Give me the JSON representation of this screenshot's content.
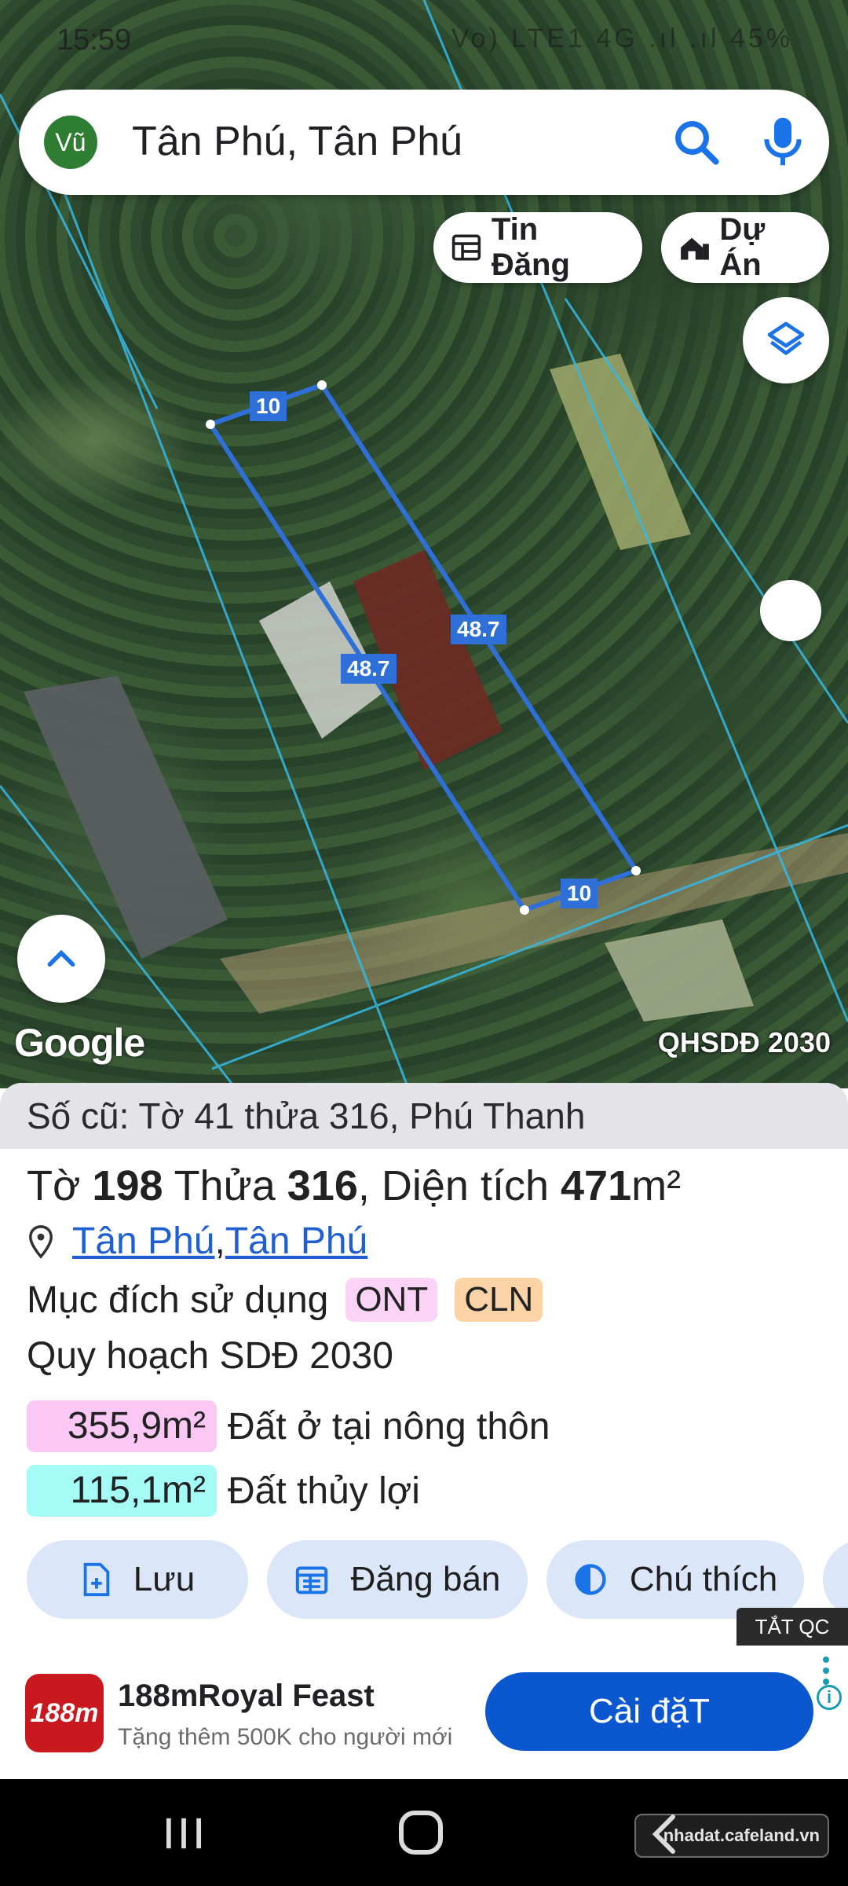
{
  "status_bar": {
    "time": "15:59",
    "indicators": "Vo) LTE1 4G .ıl .ıl 45%"
  },
  "search": {
    "avatar_text": "Vũ",
    "query": "Tân Phú, Tân Phú"
  },
  "chips": {
    "tin_dang": "Tin Đăng",
    "du_an": "Dự Án"
  },
  "map": {
    "google_label": "Google",
    "overlay_label": "QHSDĐ 2030",
    "dimensions": [
      "10",
      "48.7",
      "48.7",
      "10"
    ]
  },
  "parcel": {
    "old_info": "Số cũ: Tờ 41 thửa 316, Phú Thanh",
    "to_label": "Tờ",
    "to_number": "198",
    "thua_label": "Thửa",
    "thua_number": "316",
    "area_label": ", Diện tích",
    "area_value": "471",
    "area_unit": "m²",
    "location": {
      "commune": "Tân Phú",
      "separator": ", ",
      "district": "Tân Phú"
    },
    "purpose_label": "Mục đích sử dụng",
    "purpose_tags": [
      "ONT",
      "CLN"
    ],
    "plan_title": "Quy hoạch SDĐ 2030",
    "land_use": [
      {
        "amount": "355,9m²",
        "label": "Đất ở tại nông thôn",
        "color": "#fbc8f5"
      },
      {
        "amount": "115,1m²",
        "label": "Đất thủy lợi",
        "color": "#a5fbf5"
      }
    ]
  },
  "actions": {
    "save": "Lưu",
    "post_sale": "Đăng bán",
    "legend": "Chú thích"
  },
  "ad_toggle": "TẮT QC",
  "ad": {
    "logo_text": "188m",
    "title": "188mRoyal Feast",
    "subtitle": "Tặng thêm 500K cho người mới",
    "cta": "Cài đặT"
  },
  "watermark": "nhadat.cafeland.vn",
  "colors": {
    "parcel_outline": "#2f6fd8",
    "primary_button": "#0b57d0",
    "action_chip_bg": "#dbe6f8"
  }
}
